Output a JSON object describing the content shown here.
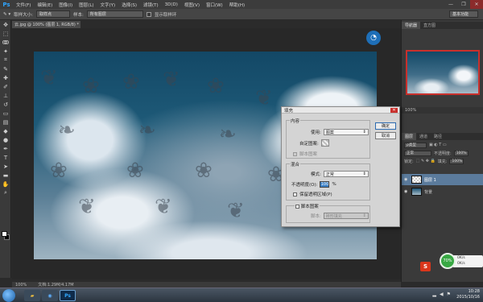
{
  "app": {
    "logo": "Ps"
  },
  "menu": [
    "文件(F)",
    "编辑(E)",
    "图像(I)",
    "图层(L)",
    "文字(Y)",
    "选择(S)",
    "滤镜(T)",
    "3D(D)",
    "视图(V)",
    "窗口(W)",
    "帮助(H)"
  ],
  "window_controls": [
    "—",
    "❐",
    "✕"
  ],
  "options": {
    "sample_size_label": "取样大小:",
    "sample_size_value": "取样点",
    "sample_label": "样本:",
    "sample_value": "所有图层",
    "show_ring_label": "显示取样环",
    "workspace": "基本功能"
  },
  "document": {
    "tab_title": "云.jpg @ 100% (图层 1, RGB/8) *",
    "zoom": "100%",
    "doc_info": "文档:1.29M/4.17M"
  },
  "panels": {
    "tabs": [
      "导航器",
      "直方图"
    ],
    "nav_zoom": "100%",
    "layer_tabs": [
      "图层",
      "通道",
      "路径"
    ],
    "kind_label": "ρ类型",
    "blend_mode": "正常",
    "opacity_label": "不透明度:",
    "opacity_value": "100%",
    "lock_label": "锁定:",
    "fill_label": "填充:",
    "fill_value": "100%",
    "layers": [
      {
        "name": "图层 1",
        "selected": true
      },
      {
        "name": "背景",
        "selected": false
      }
    ]
  },
  "dialog": {
    "title": "填充",
    "close": "✕",
    "content_legend": "内容",
    "use_label": "使用:",
    "use_value": "图案",
    "custom_pattern_label": "自定图案:",
    "script_pattern_label": "脚本图案",
    "blend_legend": "混合",
    "mode_label": "模式:",
    "mode_value": "正常",
    "opacity_label": "不透明度(O):",
    "opacity_value": "100",
    "percent": "%",
    "preserve_label": "保留透明区域(P)",
    "script_label": "脚本:",
    "script_value": "砖形填充",
    "ok": "确定",
    "cancel": "取消"
  },
  "widget": {
    "percent": "70%",
    "up": "0K/s",
    "down": "0K/s",
    "badge": "S"
  },
  "taskbar": {
    "time": "10:28",
    "date": "2015/10/16",
    "ps_label": "Ps"
  }
}
